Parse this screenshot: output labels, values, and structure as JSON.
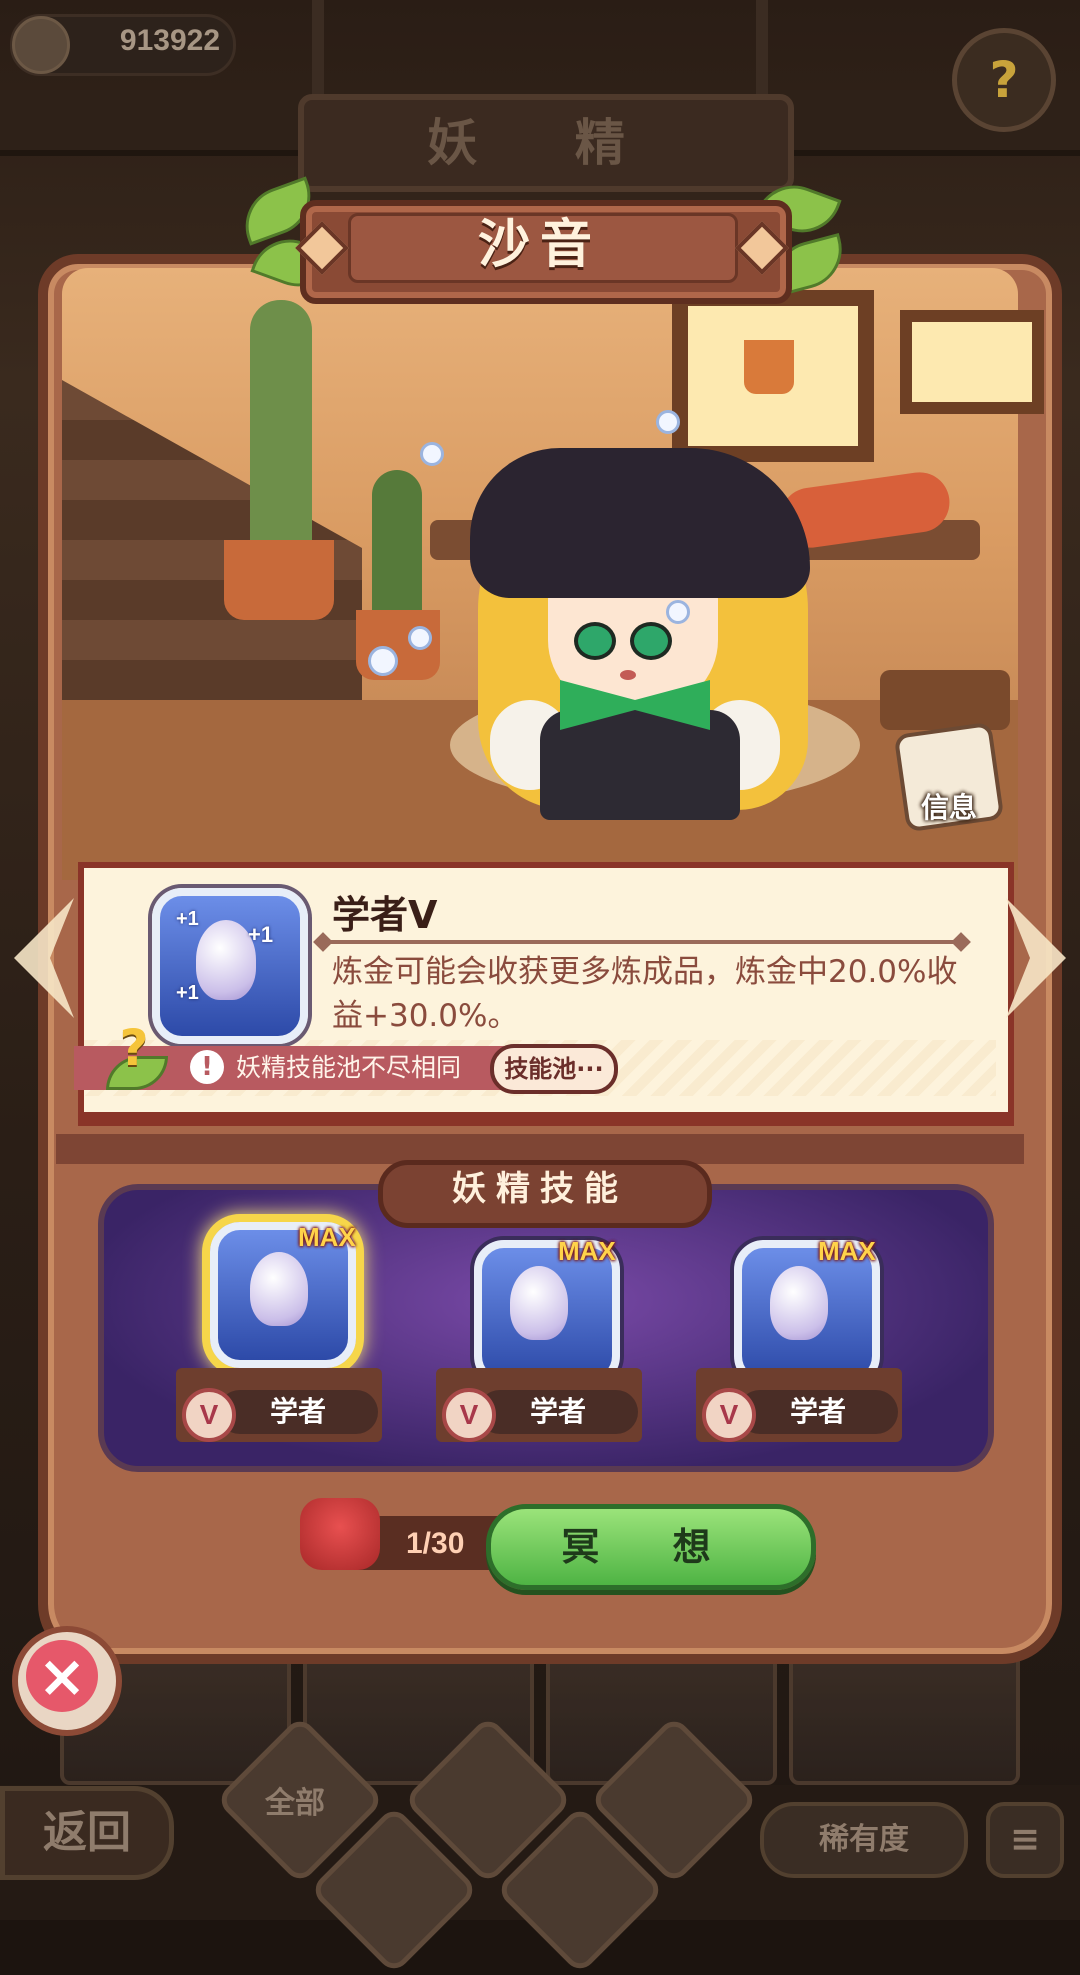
{
  "top_bar": {
    "coins_value": "913922",
    "help_icon": "question-icon"
  },
  "page_title": "妖 精",
  "fairy": {
    "name": "沙音",
    "info_label": "信息"
  },
  "selected_skill": {
    "icon": "shell-icon",
    "plus_badge": "+1",
    "title": "学者V",
    "description": "炼金可能会收获更多炼成品，炼金中20.0%收益+30.0%。",
    "warning_text": "妖精技能池不尽相同",
    "pool_button": "技能池···"
  },
  "skills_panel": {
    "title": "妖精技能",
    "slots": [
      {
        "name": "学者",
        "badge": "MAX",
        "rank": "V",
        "selected": true
      },
      {
        "name": "学者",
        "badge": "MAX",
        "rank": "V",
        "selected": false
      },
      {
        "name": "学者",
        "badge": "MAX",
        "rank": "V",
        "selected": false
      }
    ]
  },
  "meditate": {
    "cost": "1/30",
    "button_label": "冥 想"
  },
  "bottom_nav": {
    "back_label": "返回",
    "filter_all": "全部",
    "rarity_label": "稀有度",
    "order_icon": "sort-order-icon"
  },
  "colors": {
    "panel": "#a8674a",
    "accent_green": "#4fb444",
    "skill_blue": "#2d4aa8",
    "warning_red": "#b85a60"
  }
}
